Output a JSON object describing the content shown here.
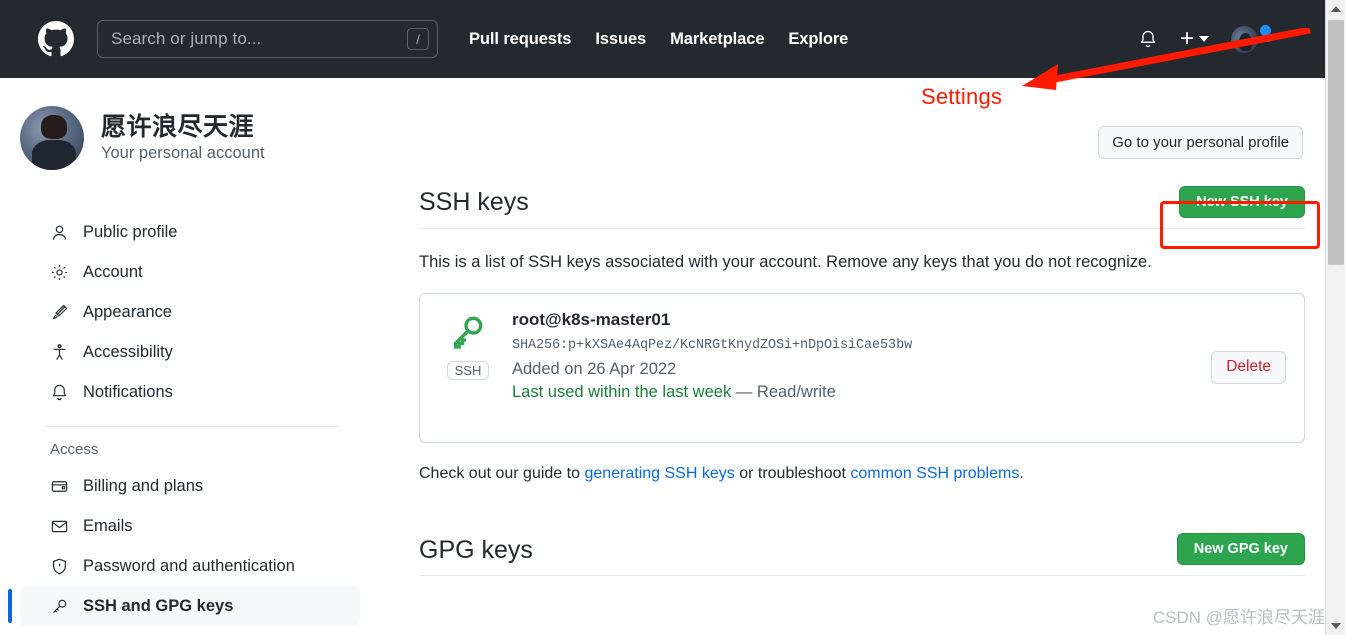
{
  "header": {
    "logo_icon": "github-mark-icon",
    "search": {
      "placeholder": "Search or jump to...",
      "value": "",
      "shortcut": "/"
    },
    "nav": [
      {
        "label": "Pull requests"
      },
      {
        "label": "Issues"
      },
      {
        "label": "Marketplace"
      },
      {
        "label": "Explore"
      }
    ],
    "icons": {
      "notifications": "bell-icon",
      "create_new": "plus-icon",
      "create_new_caret": "chevron-down-icon",
      "avatar": "user-avatar",
      "avatar_caret": "chevron-down-icon",
      "notification_dot_color": "#1f8fff"
    },
    "background_color": "#24292f"
  },
  "profile": {
    "name": "愿许浪尽天涯",
    "subtitle": "Your personal account",
    "personal_profile_button": "Go to your personal profile"
  },
  "sidebar": {
    "items": [
      {
        "label": "Public profile",
        "icon": "person-icon",
        "active": false
      },
      {
        "label": "Account",
        "icon": "gear-icon",
        "active": false
      },
      {
        "label": "Appearance",
        "icon": "paintbrush-icon",
        "active": false
      },
      {
        "label": "Accessibility",
        "icon": "accessibility-icon",
        "active": false
      },
      {
        "label": "Notifications",
        "icon": "bell-icon",
        "active": false
      }
    ],
    "group_label": "Access",
    "access_items": [
      {
        "label": "Billing and plans",
        "icon": "credit-card-icon",
        "active": false
      },
      {
        "label": "Emails",
        "icon": "mail-icon",
        "active": false
      },
      {
        "label": "Password and authentication",
        "icon": "shield-check-icon",
        "active": false
      },
      {
        "label": "SSH and GPG keys",
        "icon": "key-icon",
        "active": true
      }
    ],
    "active_accent_color": "#0969da"
  },
  "main": {
    "ssh_section": {
      "title": "SSH keys",
      "new_key_button": "New SSH key",
      "description": "This is a list of SSH keys associated with your account. Remove any keys that you do not recognize.",
      "keys": [
        {
          "icon": "key-icon",
          "badge": "SSH",
          "title": "root@k8s-master01",
          "fingerprint": "SHA256:p+kXSAe4AqPez/KcNRGtKnydZOSi+nDpOisiCae53bw",
          "added": "Added on 26 Apr 2022",
          "last_used": "Last used within the last week",
          "access": "— Read/write",
          "delete_button": "Delete"
        }
      ],
      "guide": {
        "prefix": "Check out our guide to ",
        "link1": "generating SSH keys",
        "middle": " or troubleshoot ",
        "link2": "common SSH problems",
        "suffix": "."
      }
    },
    "gpg_section": {
      "title": "GPG keys",
      "new_key_button": "New GPG key"
    },
    "button_green_color": "#2da44e",
    "link_color": "#0969da",
    "danger_color": "#cf222e",
    "success_color": "#1a7f37"
  },
  "annotations": {
    "settings_label": "Settings",
    "arrow_color": "#ff1a00",
    "highlight_color": "#ff1a00",
    "watermark": "CSDN @愿许浪尽天涯"
  },
  "scrollbar": {
    "up_arrow": "chevron-up-icon",
    "down_arrow": "chevron-down-icon"
  }
}
